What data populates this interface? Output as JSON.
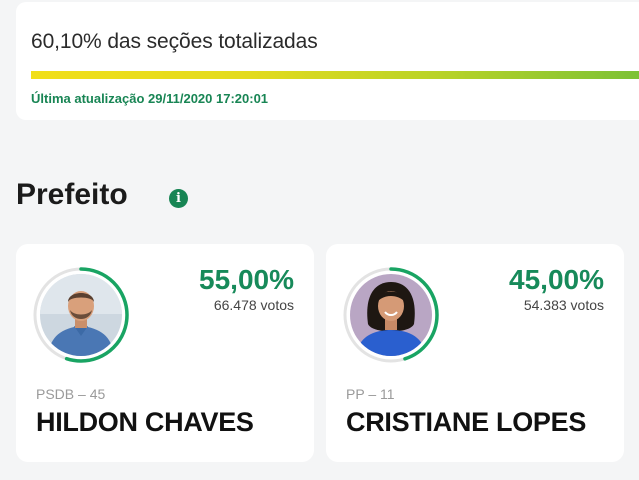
{
  "status": {
    "sections_text": "60,10% das seções totalizadas",
    "sections_progress": 0.601,
    "last_update": "Última atualização 29/11/2020 17:20:01"
  },
  "section": {
    "title": "Prefeito",
    "info_icon": "i"
  },
  "colors": {
    "accent_green": "#178a5a",
    "progress_start": "#f1df19",
    "progress_end": "#77c036"
  },
  "candidates": [
    {
      "percent": "55,00%",
      "percent_value": 55.0,
      "votes": "66.478 votos",
      "party": "PSDB – 45",
      "name": "HILDON CHAVES",
      "avatar_icon": "candidate-photo"
    },
    {
      "percent": "45,00%",
      "percent_value": 45.0,
      "votes": "54.383 votos",
      "party": "PP – 11",
      "name": "CRISTIANE LOPES",
      "avatar_icon": "candidate-photo"
    }
  ]
}
